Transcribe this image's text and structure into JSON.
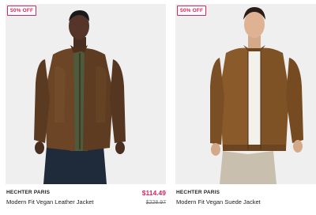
{
  "products": [
    {
      "badge": "50% OFF",
      "brand": "HECHTER PARIS",
      "name": "Modern Fit Vegan Leather Jacket",
      "sale_price": "$114.49",
      "original_price": "$228.97",
      "image_alt": "Man wearing brown vegan leather jacket"
    },
    {
      "badge": "50% OFF",
      "brand": "HECHTER PARIS",
      "name": "Modern Fit Vegan Suede Jacket",
      "image_alt": "Man wearing brown vegan suede jacket"
    }
  ],
  "colors": {
    "sale": "#d7265c",
    "photo_background": "#efeff0",
    "leather_jacket": "#6b4526",
    "suede_jacket": "#8a5a2b"
  }
}
